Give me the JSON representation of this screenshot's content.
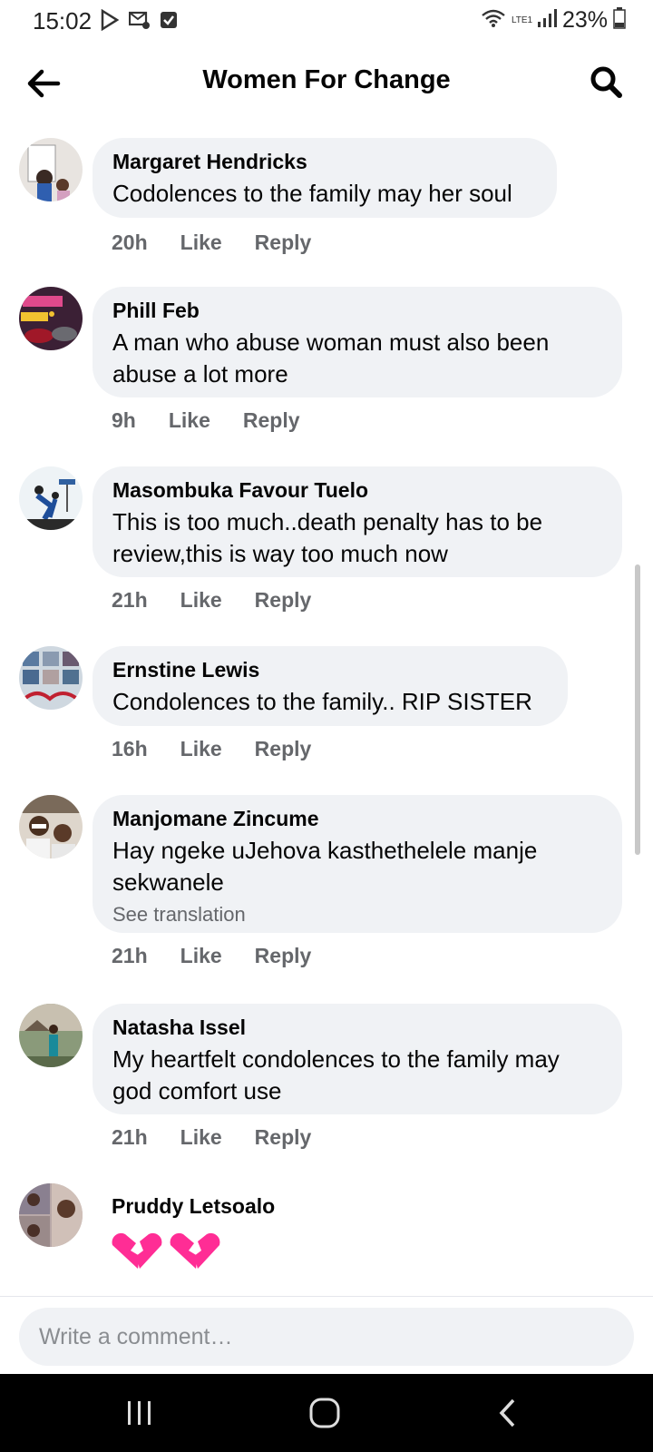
{
  "status_bar": {
    "time": "15:02",
    "battery": "23%",
    "network_label": "LTE1"
  },
  "header": {
    "title": "Women For Change"
  },
  "comments": [
    {
      "author": "Margaret Hendricks",
      "text": "Codolences to the family may her soul",
      "time": "20h",
      "like": "Like",
      "reply": "Reply"
    },
    {
      "author": "Phill Feb",
      "text": "A man who abuse woman must also been abuse a lot more",
      "time": "9h",
      "like": "Like",
      "reply": "Reply"
    },
    {
      "author": "Masombuka Favour Tuelo",
      "text": "This is too much..death penalty has to be review,this is way too much now",
      "time": "21h",
      "like": "Like",
      "reply": "Reply"
    },
    {
      "author": "Ernstine Lewis",
      "text": "Condolences to the family.. RIP SISTER",
      "time": "16h",
      "like": "Like",
      "reply": "Reply"
    },
    {
      "author": "Manjomane Zincume",
      "text": "Hay ngeke uJehova kasthethelele manje sekwanele",
      "see_translation": "See translation",
      "time": "21h",
      "like": "Like",
      "reply": "Reply"
    },
    {
      "author": "Natasha Issel",
      "text": "My heartfelt condolences to the family may god comfort use",
      "time": "21h",
      "like": "Like",
      "reply": "Reply"
    },
    {
      "author": "Pruddy Letsoalo",
      "emoji": "broken-heart-emoji x3"
    }
  ],
  "composer": {
    "placeholder": "Write a comment…"
  },
  "colors": {
    "bubble_bg": "#f0f2f5",
    "secondary_text": "#65676b",
    "heart_pink": "#ff2d95"
  }
}
